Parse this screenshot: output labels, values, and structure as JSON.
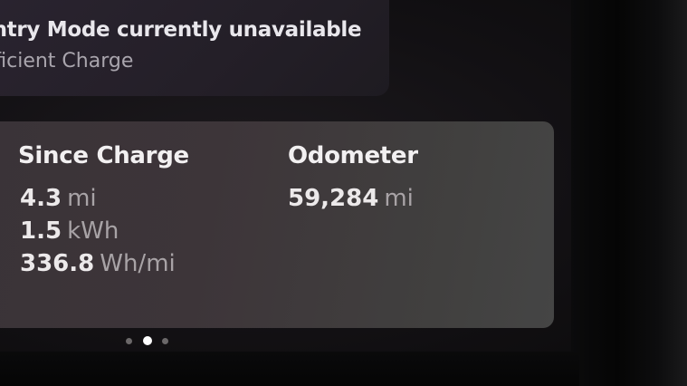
{
  "alert": {
    "title": "Sentry Mode currently unavailable",
    "subtitle": "Insufficient Charge"
  },
  "since_charge": {
    "title": "Since Charge",
    "rows": [
      {
        "value": "4.3",
        "unit": "mi"
      },
      {
        "value": "1.5",
        "unit": "kWh"
      },
      {
        "value": "336.8",
        "unit": "Wh/mi"
      }
    ]
  },
  "odometer": {
    "title": "Odometer",
    "value": "59,284",
    "unit": "mi"
  },
  "pagination": {
    "count": 3,
    "active_index": 1
  }
}
